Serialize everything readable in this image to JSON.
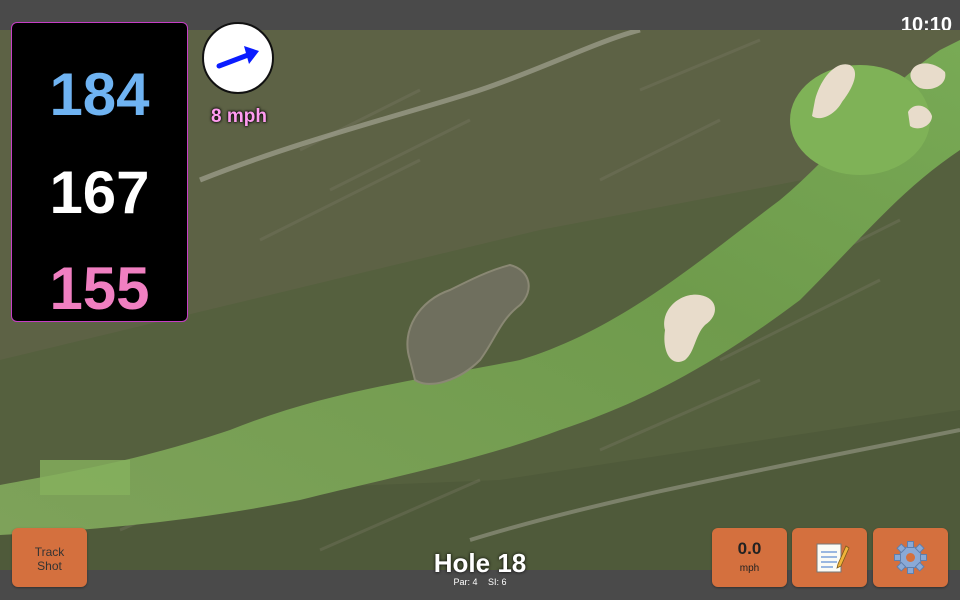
{
  "status_bar": {
    "time": "10:10"
  },
  "distances": {
    "back": "184",
    "middle": "167",
    "front": "155"
  },
  "wind": {
    "speed_label": "8 mph",
    "icon": "wind-arrow-icon"
  },
  "buttons": {
    "track_shot_line1": "Track",
    "track_shot_line2": "Shot",
    "speed_value": "0.0",
    "speed_unit": "mph",
    "notes_icon": "notepad-icon",
    "settings_icon": "gear-icon"
  },
  "hole": {
    "title": "Hole 18",
    "par": "Par: 4",
    "si": "SI: 6"
  },
  "colors": {
    "back_distance": "#6fb3f2",
    "middle_distance": "#ffffff",
    "front_distance": "#f07fc1",
    "button": "#d4703e",
    "panel_border": "#c63ec6"
  }
}
